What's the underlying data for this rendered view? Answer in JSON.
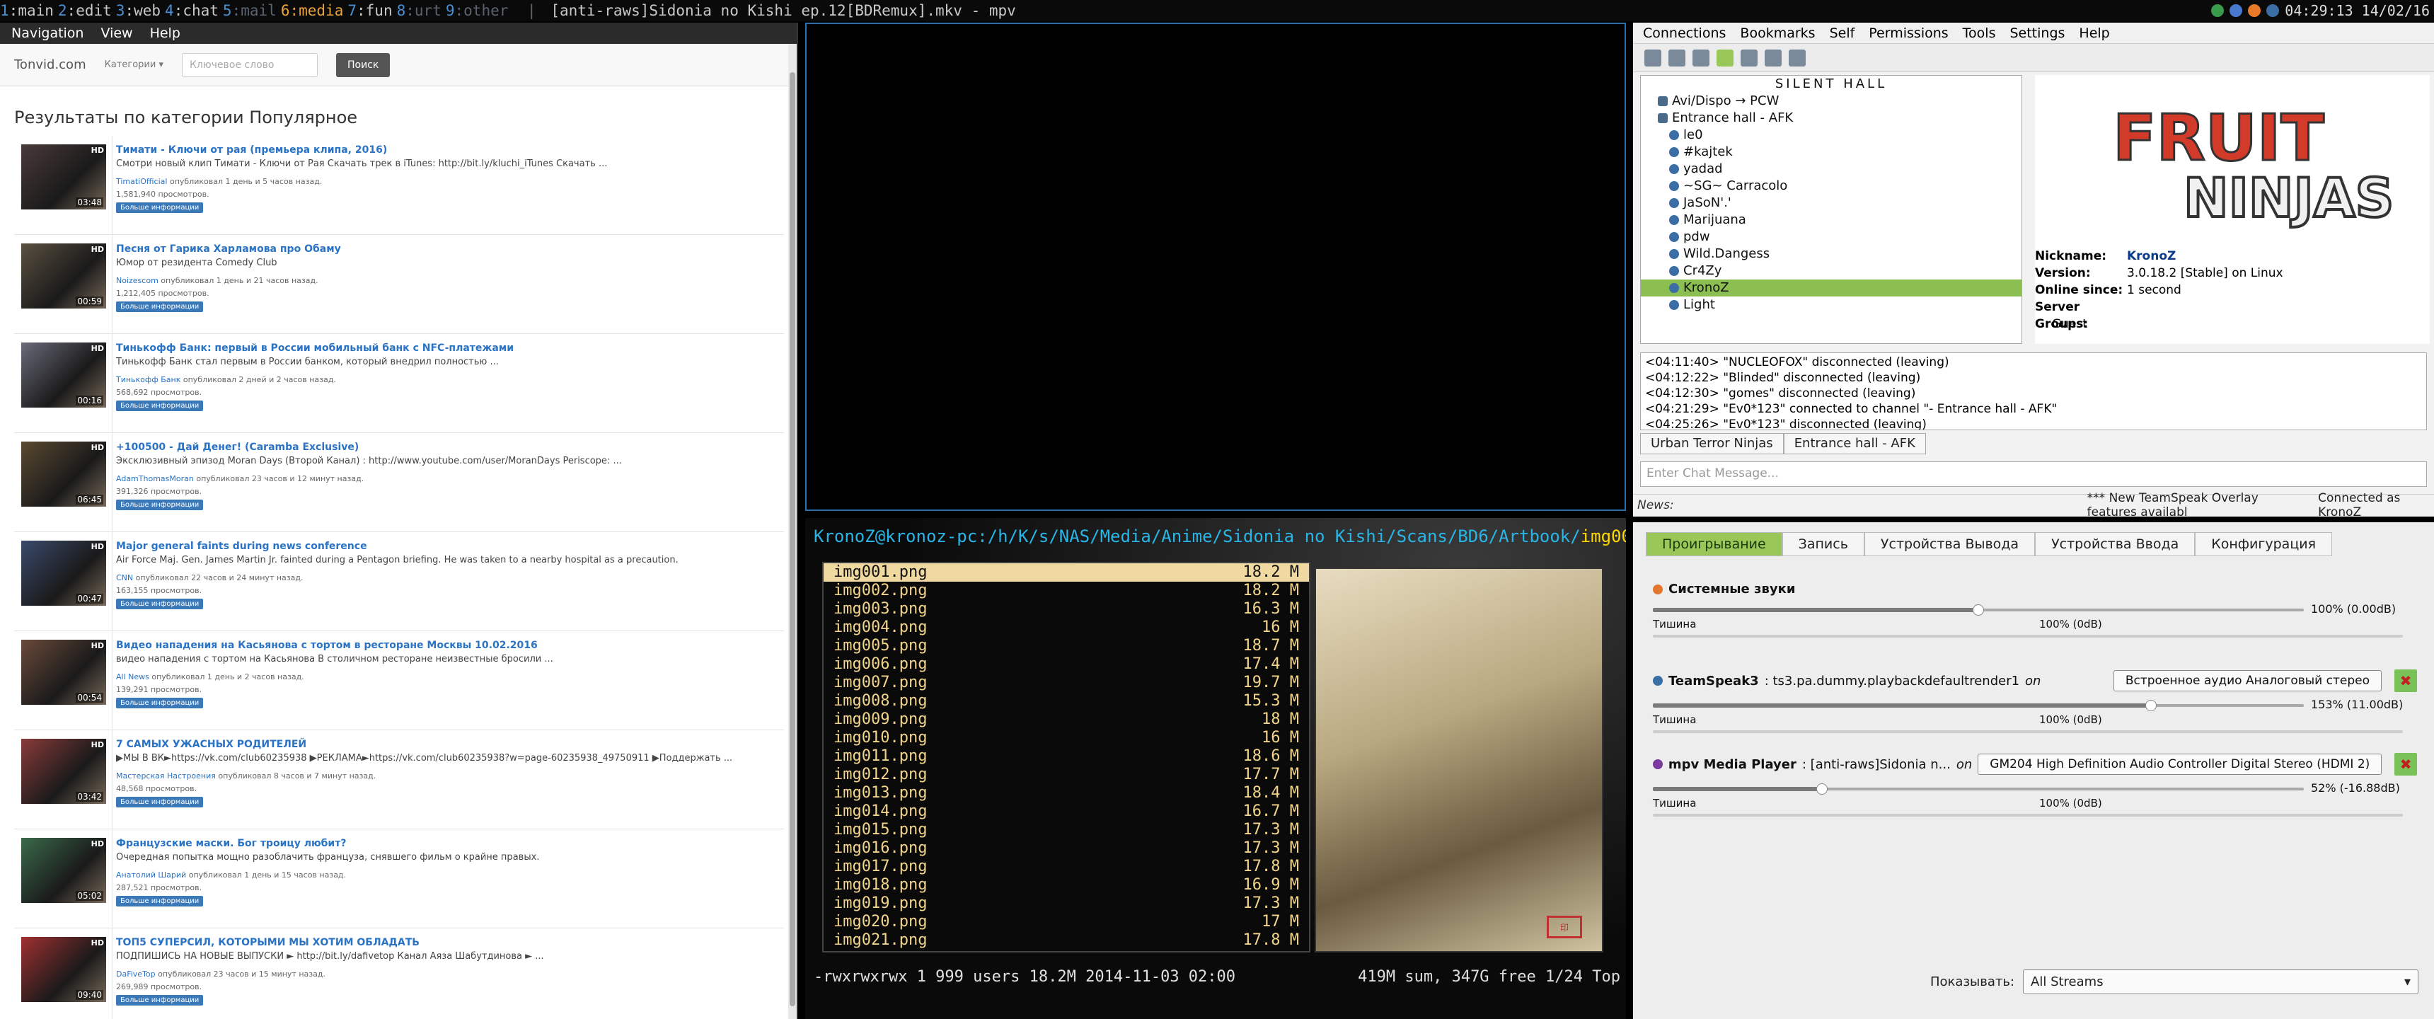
{
  "topbar": {
    "workspaces": [
      {
        "num": "1",
        "name": "main"
      },
      {
        "num": "2",
        "name": "edit"
      },
      {
        "num": "3",
        "name": "web"
      },
      {
        "num": "4",
        "name": "chat"
      },
      {
        "num": "5",
        "name": "mail"
      },
      {
        "num": "6",
        "name": "media"
      },
      {
        "num": "7",
        "name": "fun"
      },
      {
        "num": "8",
        "name": "urt"
      },
      {
        "num": "9",
        "name": "other"
      }
    ],
    "window_title": "[anti-raws]Sidonia no Kishi ep.12[BDRemux].mkv - mpv",
    "clock": "04:29:13 14/02/16"
  },
  "browser": {
    "menu": [
      "Navigation",
      "View",
      "Help"
    ],
    "site": {
      "logo": "Tonvid.com",
      "categories": "Категории",
      "search_placeholder": "Ключевое слово",
      "search_button": "Поиск"
    },
    "heading": "Результаты по категории Популярное",
    "more_label": "Больше информации",
    "videos": [
      {
        "title": "Тимати - Ключи от рая (премьера клипа, 2016)",
        "desc": "Смотри новый клип Тимати - Ключи от Рая Скачать трек в iTunes: http://bit.ly/kluchi_iTunes Скачать ...",
        "author": "TimatiOfficial",
        "meta": "опубликовал 1 день и 5 часов назад.",
        "views": "1,581,940 просмотров.",
        "duration": "03:48",
        "badge": "HD"
      },
      {
        "title": "Песня от Гарика Харламова про Обаму",
        "desc": "Юмор от резидента Comedy Club",
        "author": "Noizescom",
        "meta": "опубликовал 1 день и 21 часов назад.",
        "views": "1,212,405 просмотров.",
        "duration": "00:59",
        "badge": "HD"
      },
      {
        "title": "Тинькофф Банк: первый в России мобильный банк с NFC-платежами",
        "desc": "Тинькофф Банк стал первым в России банком, который внедрил полностью ...",
        "author": "Тинькофф Банк",
        "meta": "опубликовал 2 дней и 2 часов назад.",
        "views": "568,692 просмотров.",
        "duration": "00:16",
        "badge": "HD"
      },
      {
        "title": "+100500 - Дай Денег! (Caramba Exclusive)",
        "desc": "Эксклюзивный эпизод Moran Days (Второй Канал) : http://www.youtube.com/user/MoranDays Periscope: ...",
        "author": "AdamThomasMoran",
        "meta": "опубликовал 23 часов и 12 минут назад.",
        "views": "391,326 просмотров.",
        "duration": "06:45",
        "badge": "HD"
      },
      {
        "title": "Major general faints during news conference",
        "desc": "Air Force Maj. Gen. James Martin Jr. fainted during a Pentagon briefing. He was taken to a nearby hospital as a precaution.",
        "author": "CNN",
        "meta": "опубликовал 22 часов и 24 минут назад.",
        "views": "163,155 просмотров.",
        "duration": "00:47",
        "badge": "HD"
      },
      {
        "title": "Видео нападения на Касьянова с тортом в ресторане Москвы 10.02.2016",
        "desc": "видео нападения с тортом на Касьянова В столичном ресторане неизвестные бросили ...",
        "author": "All News",
        "meta": "опубликовал 1 день и 2 часов назад.",
        "views": "139,291 просмотров.",
        "duration": "00:54",
        "badge": "HD"
      },
      {
        "title": "7 САМЫХ УЖАСНЫХ РОДИТЕЛЕЙ",
        "desc": "▶МЫ В ВК►https://vk.com/club60235938 ▶РЕКЛАМА►https://vk.com/club60235938?w=page-60235938_49750911 ▶Поддержать ...",
        "author": "Мастерская Настроения",
        "meta": "опубликовал 8 часов и 7 минут назад.",
        "views": "48,568 просмотров.",
        "duration": "03:42",
        "badge": "HD"
      },
      {
        "title": "Французские маски. Бог троицу любит?",
        "desc": "Очередная попытка мощно разоблачить француза, снявшего фильм о крайне правых.",
        "author": "Анатолий Шарий",
        "meta": "опубликовал 1 день и 15 часов назад.",
        "views": "287,521 просмотров.",
        "duration": "05:02",
        "badge": "HD"
      },
      {
        "title": "ТОП5 СУПЕРСИЛ, КОТОРЫМИ МЫ ХОТИМ ОБЛАДАТЬ",
        "desc": "ПОДПИШИСЬ НА НОВЫЕ ВЫПУСКИ ► http://bit.ly/dafivetop Канал Аяза Шабутдинова ► ...",
        "author": "DaFiveTop",
        "meta": "опубликовал 23 часов и 15 минут назад.",
        "views": "269,989 просмотров.",
        "duration": "09:40",
        "badge": "HD"
      }
    ]
  },
  "terminal": {
    "user": "KronoZ@kronoz-pc",
    "path": ":/h/K/s/NAS/Media/Anime/Sidonia no Kishi/Scans/BD6/Artbook/",
    "file": "img001.png",
    "files": [
      {
        "name": "img001.png",
        "size": "18.2 M"
      },
      {
        "name": "img002.png",
        "size": "18.2 M"
      },
      {
        "name": "img003.png",
        "size": "16.3 M"
      },
      {
        "name": "img004.png",
        "size": "16 M"
      },
      {
        "name": "img005.png",
        "size": "18.7 M"
      },
      {
        "name": "img006.png",
        "size": "17.4 M"
      },
      {
        "name": "img007.png",
        "size": "19.7 M"
      },
      {
        "name": "img008.png",
        "size": "15.3 M"
      },
      {
        "name": "img009.png",
        "size": "18 M"
      },
      {
        "name": "img010.png",
        "size": "16 M"
      },
      {
        "name": "img011.png",
        "size": "18.6 M"
      },
      {
        "name": "img012.png",
        "size": "17.7 M"
      },
      {
        "name": "img013.png",
        "size": "18.4 M"
      },
      {
        "name": "img014.png",
        "size": "16.7 M"
      },
      {
        "name": "img015.png",
        "size": "17.3 M"
      },
      {
        "name": "img016.png",
        "size": "17.3 M"
      },
      {
        "name": "img017.png",
        "size": "17.8 M"
      },
      {
        "name": "img018.png",
        "size": "16.9 M"
      },
      {
        "name": "img019.png",
        "size": "17.3 M"
      },
      {
        "name": "img020.png",
        "size": "17 M"
      },
      {
        "name": "img021.png",
        "size": "17.8 M"
      }
    ],
    "status_left": "-rwxrwxrwx 1 999 users 18.2M 2014-11-03 02:00",
    "status_right": "419M sum, 347G free  1/24  Top"
  },
  "teamspeak": {
    "menu": [
      "Connections",
      "Bookmarks",
      "Self",
      "Permissions",
      "Tools",
      "Settings",
      "Help"
    ],
    "tree_title": "SILENT HALL",
    "tree": [
      {
        "label": "Avi/Dispo → PCW",
        "level": 0
      },
      {
        "label": "Entrance hall - AFK",
        "level": 0
      },
      {
        "label": "le0",
        "level": 1
      },
      {
        "label": "#kajtek",
        "level": 1
      },
      {
        "label": "yadad",
        "level": 1
      },
      {
        "label": "~SG~ Carracolo",
        "level": 1
      },
      {
        "label": "JaSoN'.'",
        "level": 1
      },
      {
        "label": "Marijuana",
        "level": 1
      },
      {
        "label": "pdw",
        "level": 1
      },
      {
        "label": "Wild.Dangess",
        "level": 1
      },
      {
        "label": "Cr4Zy",
        "level": 1
      },
      {
        "label": "KronoZ",
        "level": 1,
        "selected": true
      },
      {
        "label": "Light",
        "level": 1
      }
    ],
    "banner": {
      "line1": "FRUIT",
      "line2": "NINJAS"
    },
    "info": {
      "nick_k": "Nickname:",
      "nick_v": "KronoZ",
      "ver_k": "Version:",
      "ver_v": "3.0.18.2 [Stable] on Linux",
      "online_k": "Online since:",
      "online_v": "1 second",
      "groups_k": "Server Groups:",
      "groups_v": "Guest"
    },
    "log": [
      "<04:11:40> \"NUCLEOFOX\" disconnected (leaving)",
      "<04:12:22> \"Blinded\" disconnected (leaving)",
      "<04:12:30> \"gomes\" disconnected (leaving)",
      "<04:21:29> \"Ev0*123\" connected to channel \"- Entrance hall - AFK\"",
      "<04:25:26> \"Ev0*123\" disconnected (leaving)"
    ],
    "tabs": [
      "Urban Terror Ninjas",
      "Entrance hall - AFK"
    ],
    "chat_placeholder": "Enter Chat Message...",
    "news_label": "News:",
    "news_text": "*** New TeamSpeak Overlay features availabl",
    "connected": "Connected as KronoZ"
  },
  "pavucontrol": {
    "tabs": [
      "Проигрывание",
      "Запись",
      "Устройства Вывода",
      "Устройства Ввода",
      "Конфигурация"
    ],
    "silence": "Тишина",
    "zero": "100% (0dB)",
    "streams": [
      {
        "name": "Системные звуки",
        "app": "",
        "on": "",
        "device": "",
        "pct": "100% (0.00dB)",
        "level": 0.5
      },
      {
        "name": "TeamSpeak3",
        "app": ": ts3.pa.dummy.playbackdefaultrender1",
        "on": "on",
        "device": "Встроенное аудио Аналоговый стерео",
        "pct": "153% (11.00dB)",
        "level": 0.765
      },
      {
        "name": "mpv Media Player",
        "app": ": [anti-raws]Sidonia n...",
        "on": "on",
        "device": "GM204 High Definition Audio Controller Digital Stereo (HDMI 2)",
        "pct": "52% (-16.88dB)",
        "level": 0.26
      }
    ],
    "show_label": "Показывать:",
    "show_value": "All Streams"
  }
}
